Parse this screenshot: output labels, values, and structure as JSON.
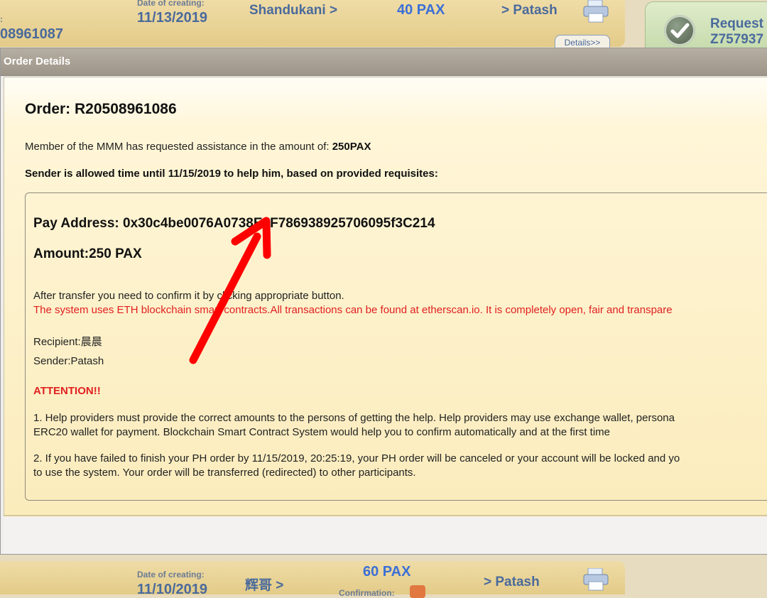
{
  "background": {
    "top_row": {
      "order_id_partial": "08961087",
      "date_label": "Date of creating:",
      "date_value": "11/13/2019",
      "recipient_link": "Shandukani >",
      "amount": "40 PAX",
      "sender_link": "> Patash",
      "details_button": "Details>>",
      "label_partial": ":"
    },
    "request_card": {
      "line1": "Request",
      "line2": "Z757937"
    },
    "bottom_row": {
      "date_label": "Date of creating:",
      "date_value": "11/10/2019",
      "recipient_link": "辉哥 >",
      "amount": "60 PAX",
      "confirmation_label": "Confirmation:",
      "sender_link": "> Patash"
    }
  },
  "dialog": {
    "title": "Order Details",
    "order_heading": "Order: R20508961086",
    "intro_text": "Member of the MMM has requested assistance in the amount of: ",
    "intro_amount": "250PAX",
    "sender_note": "Sender is allowed time until 11/15/2019 to help him, based on provided requisites:",
    "pay_address": "Pay Address: 0x30c4be0076A0738E2F786938925706095f3C214",
    "amount": "Amount:250 PAX",
    "after_transfer": "After transfer you need to confirm it by clicking appropriate button.",
    "system_note": "The system uses ETH blockchain smart contracts.All transactions can be found at etherscan.io. It is completely open, fair and transpare",
    "recipient": "Recipient:晨晨",
    "sender": "Sender:Patash",
    "attention": "ATTENTION!!",
    "para1_line1": "1. Help providers must provide the correct amounts to the persons of getting the help. Help providers may use exchange wallet, persona",
    "para1_line2": "ERC20 wallet for payment. Blockchain Smart Contract System would help you to confirm automatically and at the first time",
    "para2_line1": "2. If you have failed to finish your PH order by 11/15/2019, 20:25:19, your PH order will be canceled or your account will be locked and yo",
    "para2_line2": "to use the system. Your order will be transferred (redirected) to other participants."
  },
  "colors": {
    "arrow": "#ff0000",
    "warning_text": "#e02020",
    "link_blue": "#4a6a9c",
    "pax_blue": "#3b6fd6"
  }
}
